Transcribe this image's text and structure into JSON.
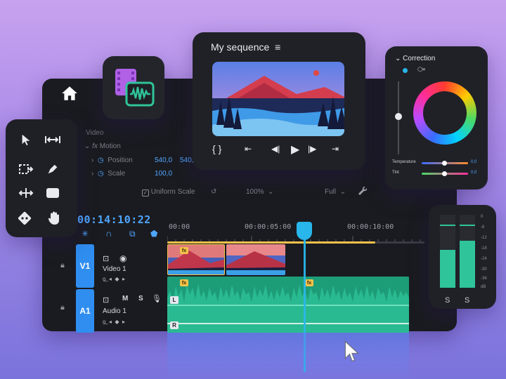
{
  "preview": {
    "title": "My sequence"
  },
  "effects": {
    "section": "Video",
    "motion": "Motion",
    "position_label": "Position",
    "position_x": "540,0",
    "position_y": "540,",
    "scale_label": "Scale",
    "scale_value": "100,0",
    "uniform_scale": "Uniform Scale",
    "zoom": "100%",
    "resolution": "Full"
  },
  "timeline": {
    "timecode": "00:14:10:22",
    "ruler": [
      "00:00",
      "00:00:05:00",
      "00:00:10:00"
    ],
    "tracks": [
      {
        "id": "V1",
        "name": "Video 1"
      },
      {
        "id": "A1",
        "name": "Audio 1",
        "mute": "M",
        "solo": "S"
      }
    ],
    "fx_label": "fx",
    "left_channel": "L",
    "right_channel": "R"
  },
  "correction": {
    "title": "Correction",
    "temperature_label": "Temperature",
    "temperature_value": "0,0",
    "tint_label": "Tint",
    "tint_value": "0,0"
  },
  "meters": {
    "scale": [
      "0",
      "-6",
      "-12",
      "-18",
      "-24",
      "-30",
      "-36",
      "dB"
    ],
    "left_label": "S",
    "right_label": "S",
    "left_level": 0.52,
    "right_level": 0.64
  },
  "colors": {
    "accent": "#2f8ef0",
    "audio": "#2fc49a",
    "fx": "#f2c24a",
    "playhead": "#29b6ea"
  }
}
